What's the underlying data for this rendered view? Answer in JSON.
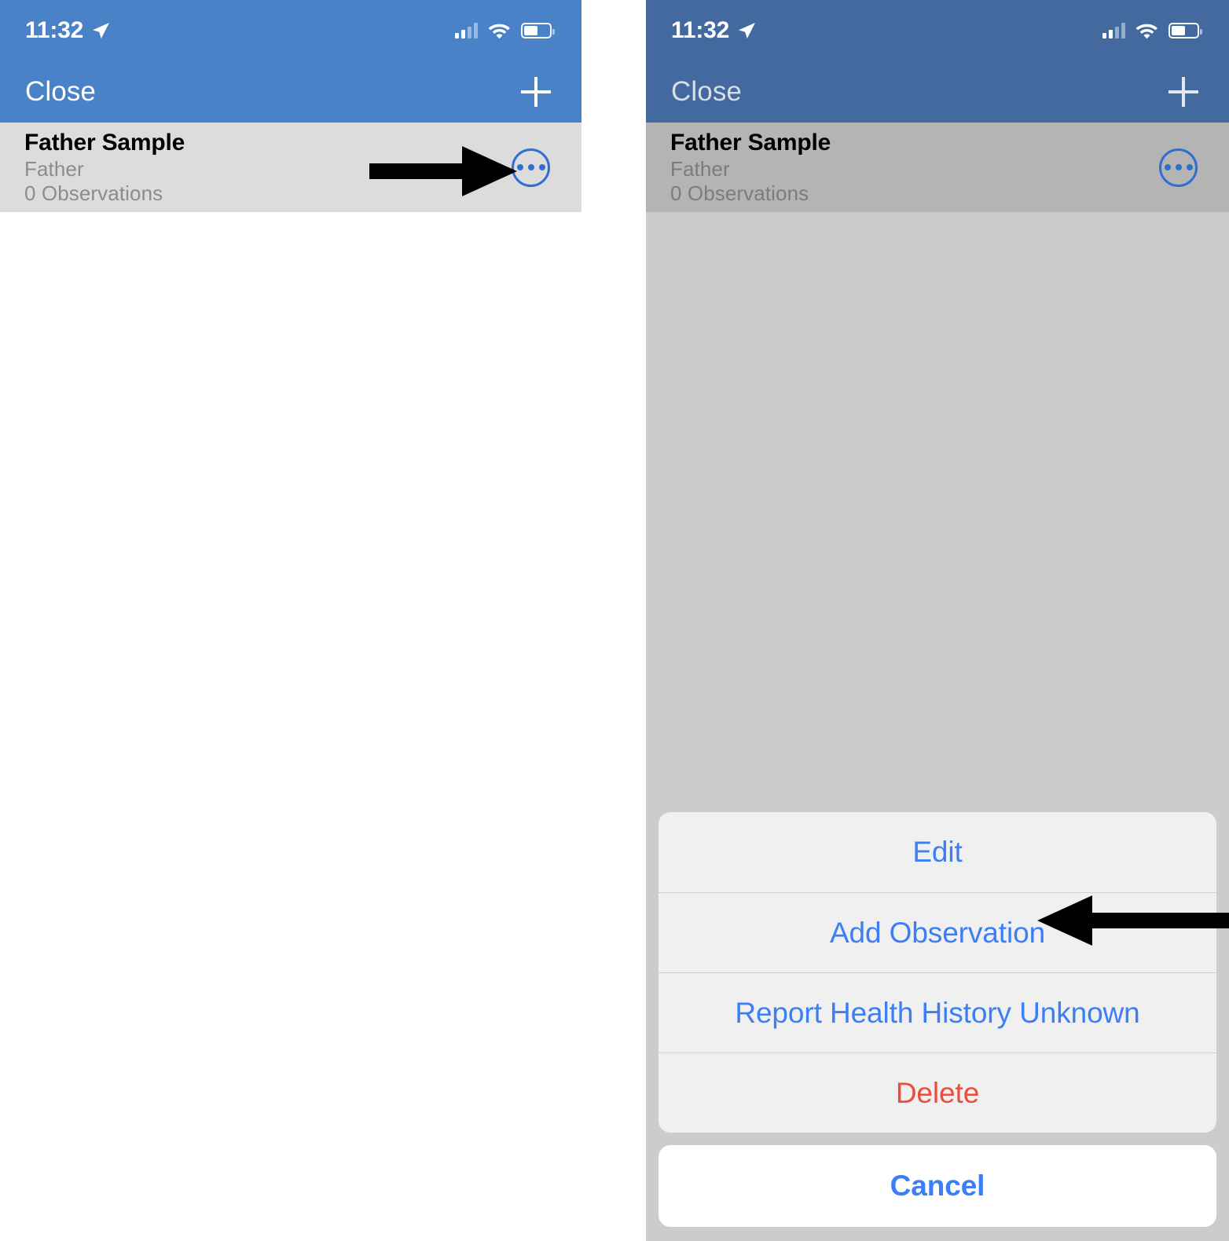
{
  "panels": [
    {
      "id": "before",
      "status_bar": {
        "time": "11:32",
        "location_icon": "location-arrow-icon",
        "cellular_icon": "cellular-signal-icon",
        "wifi_icon": "wifi-icon",
        "battery_icon": "battery-icon"
      },
      "navbar": {
        "close_label": "Close",
        "add_icon": "plus-icon"
      },
      "list_row": {
        "title": "Father Sample",
        "relationship": "Father",
        "observations": "0 Observations",
        "more_icon": "ellipsis-circle-icon"
      },
      "annotation": {
        "arrow": "arrow-pointing-right-at-more-button"
      }
    },
    {
      "id": "after",
      "status_bar": {
        "time": "11:32",
        "location_icon": "location-arrow-icon",
        "cellular_icon": "cellular-signal-icon",
        "wifi_icon": "wifi-icon",
        "battery_icon": "battery-icon"
      },
      "navbar": {
        "close_label": "Close",
        "add_icon": "plus-icon"
      },
      "list_row": {
        "title": "Father Sample",
        "relationship": "Father",
        "observations": "0 Observations",
        "more_icon": "ellipsis-circle-icon"
      },
      "action_sheet": {
        "items": [
          {
            "label": "Edit",
            "style": "blue"
          },
          {
            "label": "Add Observation",
            "style": "blue"
          },
          {
            "label": "Report Health History Unknown",
            "style": "blue"
          },
          {
            "label": "Delete",
            "style": "red"
          }
        ],
        "cancel_label": "Cancel"
      },
      "annotation": {
        "arrow": "arrow-pointing-left-at-add-observation"
      }
    }
  ],
  "colors": {
    "navbar_blue": "#4a82c8",
    "navbar_blue_dimmed": "#43699f",
    "row_gray": "#dcdcdc",
    "row_gray_dimmed": "#b4b4b4",
    "overlay_gray": "#cccccc",
    "sheet_gray": "#f0f0f0",
    "action_blue": "#3b7ef5",
    "destructive_red": "#eb4e3d",
    "more_button_blue": "#2f6fd0"
  }
}
